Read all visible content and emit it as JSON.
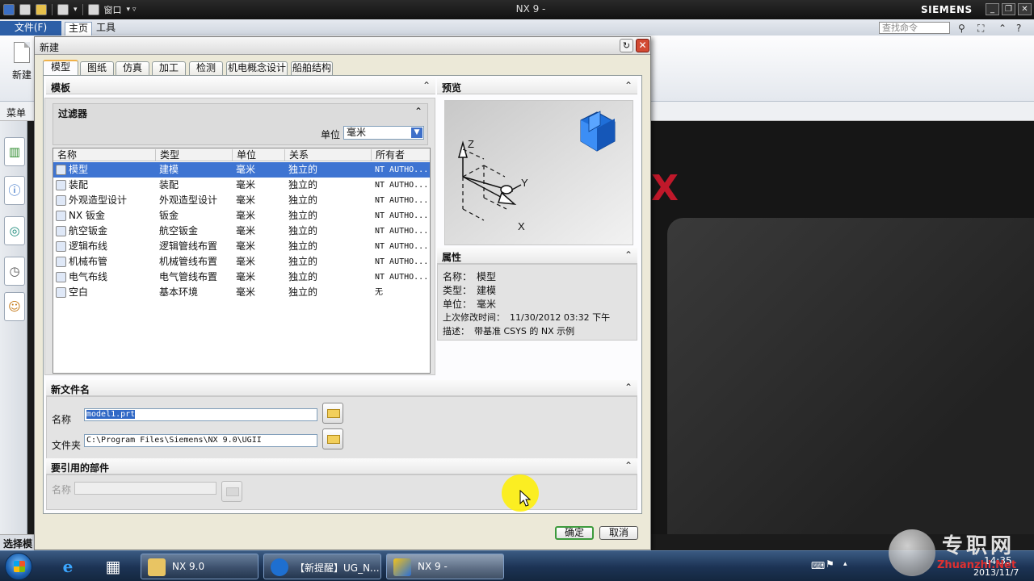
{
  "app": {
    "title": "NX 9 -",
    "brand": "SIEMENS",
    "quick_access_window": "窗口",
    "window_controls": {
      "minimize": "_",
      "restore": "❐",
      "close": "✕"
    }
  },
  "menubar": {
    "file_label": "文件(F)",
    "tabs": [
      "主页",
      "工具"
    ],
    "search_placeholder": "查找命令"
  },
  "ribbon": {
    "new_label": "新建",
    "menu_label": "菜单"
  },
  "status": {
    "text": "选择模"
  },
  "dialog": {
    "title": "新建",
    "tabs": [
      "模型",
      "图纸",
      "仿真",
      "加工",
      "检测",
      "机电概念设计",
      "船舶结构"
    ],
    "active_tab": "模型",
    "templates": {
      "header": "模板",
      "filter_header": "过滤器",
      "unit_label": "单位",
      "unit_value": "毫米",
      "columns": [
        "名称",
        "类型",
        "单位",
        "关系",
        "所有者"
      ],
      "rows": [
        {
          "name": "模型",
          "type": "建模",
          "unit": "毫米",
          "relation": "独立的",
          "owner": "NT AUTHO...",
          "selected": true
        },
        {
          "name": "装配",
          "type": "装配",
          "unit": "毫米",
          "relation": "独立的",
          "owner": "NT AUTHO..."
        },
        {
          "name": "外观造型设计",
          "type": "外观造型设计",
          "unit": "毫米",
          "relation": "独立的",
          "owner": "NT AUTHO..."
        },
        {
          "name": "NX 钣金",
          "type": "钣金",
          "unit": "毫米",
          "relation": "独立的",
          "owner": "NT AUTHO..."
        },
        {
          "name": "航空钣金",
          "type": "航空钣金",
          "unit": "毫米",
          "relation": "独立的",
          "owner": "NT AUTHO..."
        },
        {
          "name": "逻辑布线",
          "type": "逻辑管线布置",
          "unit": "毫米",
          "relation": "独立的",
          "owner": "NT AUTHO..."
        },
        {
          "name": "机械布管",
          "type": "机械管线布置",
          "unit": "毫米",
          "relation": "独立的",
          "owner": "NT AUTHO..."
        },
        {
          "name": "电气布线",
          "type": "电气管线布置",
          "unit": "毫米",
          "relation": "独立的",
          "owner": "NT AUTHO..."
        },
        {
          "name": "空白",
          "type": "基本环境",
          "unit": "毫米",
          "relation": "独立的",
          "owner": "无"
        }
      ]
    },
    "preview": {
      "header": "预览",
      "axes": [
        "Z",
        "Y",
        "X"
      ]
    },
    "properties": {
      "header": "属性",
      "items": [
        {
          "label": "名称：",
          "value": "模型"
        },
        {
          "label": "类型：",
          "value": "建模"
        },
        {
          "label": "单位：",
          "value": "毫米"
        },
        {
          "label": "上次修改时间：",
          "value": "11/30/2012 03:32 下午"
        },
        {
          "label": "描述：",
          "value": "带基准 CSYS 的 NX 示例"
        }
      ]
    },
    "new_file": {
      "header": "新文件名",
      "name_label": "名称",
      "name_value": "model1.prt",
      "folder_label": "文件夹",
      "folder_value": "C:\\Program Files\\Siemens\\NX 9.0\\UGII"
    },
    "referenced_parts": {
      "header": "要引用的部件",
      "name_label": "名称",
      "name_value": ""
    },
    "ok_label": "确定",
    "cancel_label": "取消"
  },
  "taskbar": {
    "tasks": [
      "NX 9.0",
      "【新提醒】UG_N...",
      "NX 9 -"
    ],
    "active_task": "NX 9 -",
    "time": "14:35",
    "date": "2013/11/7"
  },
  "watermark": {
    "text": "专职网",
    "url": "Zhuanzhi.Net"
  }
}
